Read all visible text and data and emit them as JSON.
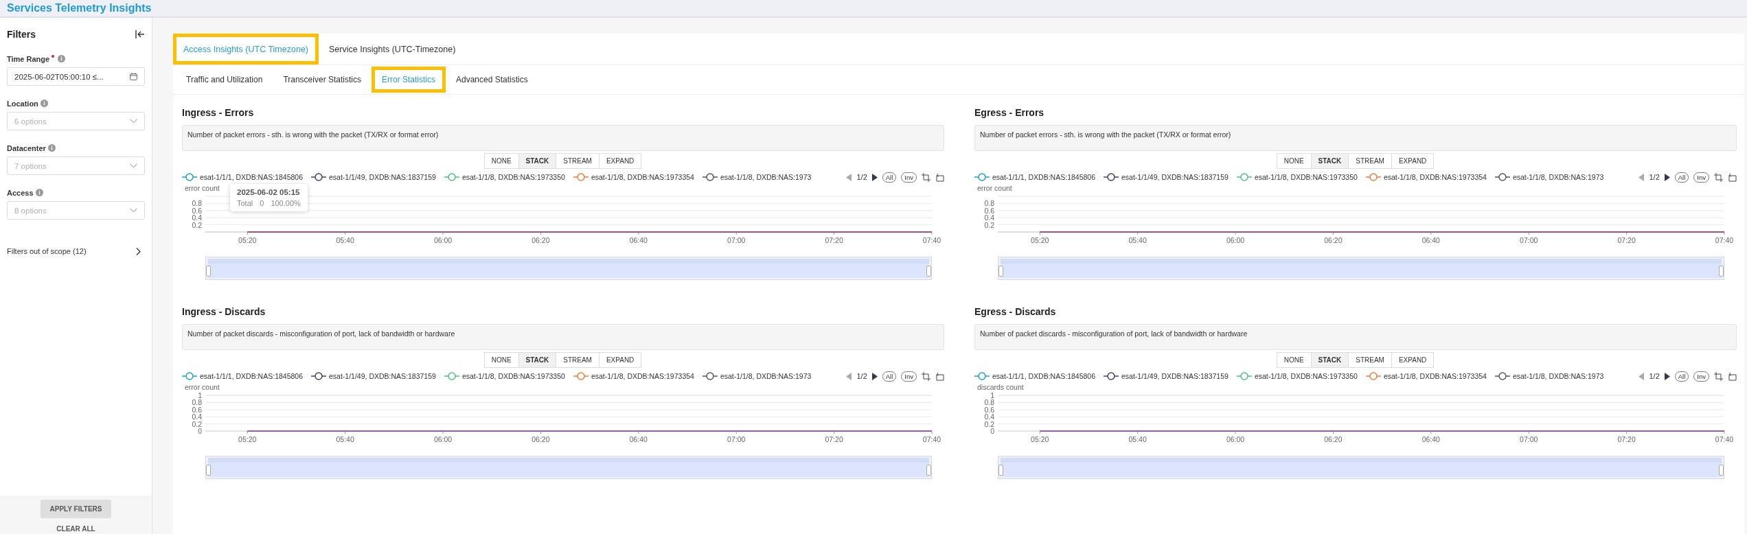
{
  "app_title": "Services Telemetry Insights",
  "filters": {
    "title": "Filters",
    "fields": [
      {
        "kind": "date",
        "label": "Time Range",
        "required": true,
        "value": "2025-06-02T05:00:10 ≤..."
      },
      {
        "kind": "select",
        "label": "Location",
        "placeholder": "6 options"
      },
      {
        "kind": "select",
        "label": "Datacenter",
        "placeholder": "7 options"
      },
      {
        "kind": "select",
        "label": "Access",
        "placeholder": "8 options"
      }
    ],
    "out_of_scope": "Filters out of scope (12)",
    "apply_button": "APPLY FILTERS",
    "clear_button": "CLEAR ALL"
  },
  "tabs": [
    {
      "label": "Access Insights (UTC Timezone)",
      "selected": true,
      "highlighted": true
    },
    {
      "label": "Service Insights (UTC-Timezone)",
      "selected": false,
      "highlighted": false
    }
  ],
  "subtabs": [
    {
      "label": "Traffic and Utilization",
      "selected": false,
      "highlighted": false
    },
    {
      "label": "Transceiver Statistics",
      "selected": false,
      "highlighted": false
    },
    {
      "label": "Error Statistics",
      "selected": true,
      "highlighted": true
    },
    {
      "label": "Advanced Statistics",
      "selected": false,
      "highlighted": false
    }
  ],
  "panels": [
    {
      "title": "Ingress - Errors",
      "description": "Number of packet errors - sth. is wrong with the packet (TX/RX or format error)",
      "modes": [
        {
          "label": "NONE",
          "selected": false
        },
        {
          "label": "STACK",
          "selected": true
        },
        {
          "label": "STREAM",
          "selected": false
        },
        {
          "label": "EXPAND",
          "selected": false
        }
      ],
      "legend": [
        {
          "name": "esat-1/1/1, DXDB:NAS:1845806",
          "color": "#1aa3c8"
        },
        {
          "name": "esat-1/1/49, DXDB:NAS:1837159",
          "color": "#3b4178"
        },
        {
          "name": "esat-1/1/8, DXDB:NAS:1973350",
          "color": "#4cc27c"
        },
        {
          "name": "esat-1/1/8, DXDB:NAS:1973354",
          "color": "#f27b3c"
        },
        {
          "name": "esat-1/1/8, DXDB:NAS:1973",
          "color": "#555555"
        }
      ],
      "pager": {
        "page": "1/2",
        "prev_disabled": true,
        "next_disabled": false
      },
      "legend_buttons": [
        "All",
        "Inv"
      ],
      "tooltip": {
        "title": "2025-06-02 05:15",
        "label": "Total",
        "value": "0",
        "share": "100.00%"
      },
      "chart_data": {
        "type": "line",
        "ylabel": "error count",
        "grid": true,
        "categories": [
          "05:20",
          "05:40",
          "06:00",
          "06:20",
          "06:40",
          "07:00",
          "07:20",
          "07:40"
        ],
        "ylim": [
          0,
          1
        ],
        "yticks": [
          0.2,
          0.4,
          0.6,
          0.8
        ],
        "series": [
          {
            "color": "#b0506e",
            "values": [
              0,
              0,
              0,
              0,
              0,
              0,
              0,
              0
            ]
          }
        ]
      },
      "slider": {
        "level": 1
      }
    },
    {
      "title": "Egress - Errors",
      "description": "Number of packet errors - sth. is wrong with the packet (TX/RX or format error)",
      "modes": [
        {
          "label": "NONE",
          "selected": false
        },
        {
          "label": "STACK",
          "selected": true
        },
        {
          "label": "STREAM",
          "selected": false
        },
        {
          "label": "EXPAND",
          "selected": false
        }
      ],
      "legend": [
        {
          "name": "esat-1/1/1, DXDB:NAS:1845806",
          "color": "#1aa3c8"
        },
        {
          "name": "esat-1/1/49, DXDB:NAS:1837159",
          "color": "#3b4178"
        },
        {
          "name": "esat-1/1/8, DXDB:NAS:1973350",
          "color": "#4cc27c"
        },
        {
          "name": "esat-1/1/8, DXDB:NAS:1973354",
          "color": "#f27b3c"
        },
        {
          "name": "esat-1/1/8, DXDB:NAS:1973",
          "color": "#555555"
        }
      ],
      "pager": {
        "page": "1/2",
        "prev_disabled": true,
        "next_disabled": false
      },
      "legend_buttons": [
        "All",
        "Inv"
      ],
      "chart_data": {
        "type": "line",
        "ylabel": "error count",
        "grid": true,
        "categories": [
          "05:20",
          "05:40",
          "06:00",
          "06:20",
          "06:40",
          "07:00",
          "07:20",
          "07:40"
        ],
        "ylim": [
          0,
          1
        ],
        "yticks": [
          0.2,
          0.4,
          0.6,
          0.8
        ],
        "series": [
          {
            "color": "#b0506e",
            "values": [
              0,
              0,
              0,
              0,
              0,
              0,
              0,
              0
            ]
          }
        ]
      },
      "slider": {
        "level": 1
      }
    },
    {
      "title": "Ingress - Discards",
      "description": "Number of packet discards - misconfiguration of port, lack of bandwidth or hardware",
      "modes": [
        {
          "label": "NONE",
          "selected": false
        },
        {
          "label": "STACK",
          "selected": true
        },
        {
          "label": "STREAM",
          "selected": false
        },
        {
          "label": "EXPAND",
          "selected": false
        }
      ],
      "legend": [
        {
          "name": "esat-1/1/1, DXDB:NAS:1845806",
          "color": "#1aa3c8"
        },
        {
          "name": "esat-1/1/49, DXDB:NAS:1837159",
          "color": "#3b4178"
        },
        {
          "name": "esat-1/1/8, DXDB:NAS:1973350",
          "color": "#4cc27c"
        },
        {
          "name": "esat-1/1/8, DXDB:NAS:1973354",
          "color": "#f27b3c"
        },
        {
          "name": "esat-1/1/8, DXDB:NAS:1973",
          "color": "#555555"
        }
      ],
      "pager": {
        "page": "1/2",
        "prev_disabled": true,
        "next_disabled": false
      },
      "legend_buttons": [
        "All",
        "Inv"
      ],
      "chart_data": {
        "type": "line",
        "ylabel": "error count",
        "grid": true,
        "categories": [
          "05:20",
          "05:40",
          "06:00",
          "06:20",
          "06:40",
          "07:00",
          "07:20",
          "07:40"
        ],
        "ylim": [
          0,
          1
        ],
        "yticks": [
          0,
          0.2,
          0.4,
          0.6,
          0.8,
          1
        ],
        "series": [
          {
            "color": "#9b59b6",
            "values": [
              0,
              0,
              0,
              0,
              0,
              0,
              0,
              0
            ]
          }
        ]
      },
      "slider": {
        "level": 1
      }
    },
    {
      "title": "Egress - Discards",
      "description": "Number of packet discards - misconfiguration of port, lack of bandwidth or hardware",
      "modes": [
        {
          "label": "NONE",
          "selected": false
        },
        {
          "label": "STACK",
          "selected": true
        },
        {
          "label": "STREAM",
          "selected": false
        },
        {
          "label": "EXPAND",
          "selected": false
        }
      ],
      "legend": [
        {
          "name": "esat-1/1/1, DXDB:NAS:1845806",
          "color": "#1aa3c8"
        },
        {
          "name": "esat-1/1/49, DXDB:NAS:1837159",
          "color": "#3b4178"
        },
        {
          "name": "esat-1/1/8, DXDB:NAS:1973350",
          "color": "#4cc27c"
        },
        {
          "name": "esat-1/1/8, DXDB:NAS:1973354",
          "color": "#f27b3c"
        },
        {
          "name": "esat-1/1/8, DXDB:NAS:1973",
          "color": "#555555"
        }
      ],
      "pager": {
        "page": "1/2",
        "prev_disabled": true,
        "next_disabled": false
      },
      "legend_buttons": [
        "All",
        "Inv"
      ],
      "chart_data": {
        "type": "line",
        "ylabel": "discards count",
        "grid": true,
        "categories": [
          "05:20",
          "05:40",
          "06:00",
          "06:20",
          "06:40",
          "07:00",
          "07:20",
          "07:40"
        ],
        "ylim": [
          0,
          1
        ],
        "yticks": [
          0,
          0.2,
          0.4,
          0.6,
          0.8,
          1
        ],
        "series": [
          {
            "color": "#9b59b6",
            "values": [
              0,
              0,
              0,
              0,
              0,
              0,
              0,
              0
            ]
          }
        ]
      },
      "slider": {
        "level": 1
      }
    }
  ]
}
